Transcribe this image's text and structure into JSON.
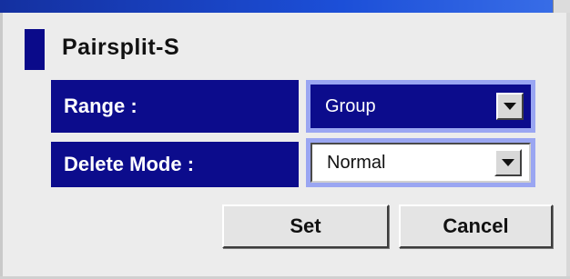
{
  "panel": {
    "title": "Pairsplit-S"
  },
  "fields": {
    "range": {
      "label": "Range :",
      "value": "Group"
    },
    "delete_mode": {
      "label": "Delete Mode :",
      "value": "Normal"
    }
  },
  "buttons": {
    "set_label": "Set",
    "cancel_label": "Cancel"
  },
  "colors": {
    "label_bg": "#0c0c8c",
    "frame_highlight": "#9aa6f2",
    "window_bg": "#ececec"
  },
  "icons": {
    "dropdown": "chevron-down-icon",
    "section_marker": "section-marker"
  }
}
